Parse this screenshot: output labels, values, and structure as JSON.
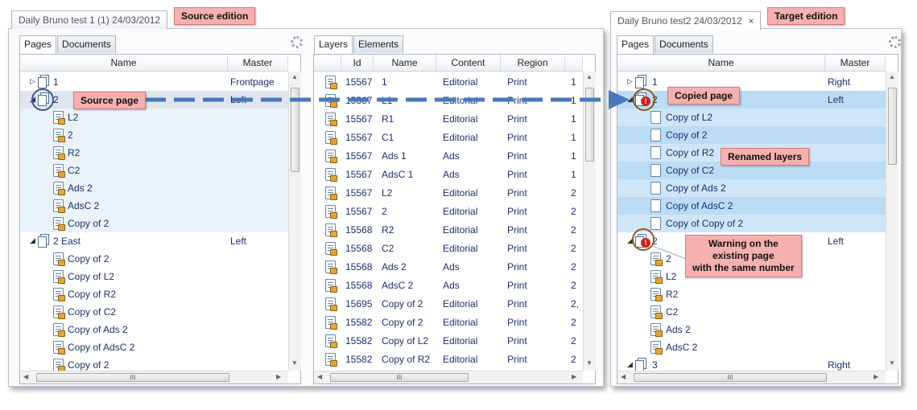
{
  "source": {
    "doc_tab": "Daily Bruno test 1 (1) 24/03/2012",
    "callout": "Source edition",
    "tabs": [
      "Pages",
      "Documents"
    ],
    "columns": [
      "Name",
      "Master"
    ],
    "rows": [
      {
        "name": "1",
        "master": "Frontpage"
      },
      {
        "name": "2",
        "master": "Left"
      },
      {
        "name": "L2",
        "master": ""
      },
      {
        "name": "2",
        "master": ""
      },
      {
        "name": "R2",
        "master": ""
      },
      {
        "name": "C2",
        "master": ""
      },
      {
        "name": "Ads 2",
        "master": ""
      },
      {
        "name": "AdsC 2",
        "master": ""
      },
      {
        "name": "Copy of 2",
        "master": ""
      },
      {
        "name": "2 East",
        "master": "Left"
      },
      {
        "name": "Copy of 2",
        "master": ""
      },
      {
        "name": "Copy of L2",
        "master": ""
      },
      {
        "name": "Copy of R2",
        "master": ""
      },
      {
        "name": "Copy of C2",
        "master": ""
      },
      {
        "name": "Copy of Ads 2",
        "master": ""
      },
      {
        "name": "Copy of AdsC 2",
        "master": ""
      },
      {
        "name": "Copy of 2",
        "master": ""
      }
    ],
    "source_page_callout": "Source page"
  },
  "middle": {
    "tabs": [
      "Layers",
      "Elements"
    ],
    "columns": [
      "Id",
      "Name",
      "Content",
      "Region"
    ],
    "rows": [
      [
        "15567",
        "1",
        "Editorial",
        "Print",
        "1"
      ],
      [
        "15567",
        "L1",
        "Editorial",
        "Print",
        "1"
      ],
      [
        "15567",
        "R1",
        "Editorial",
        "Print",
        "1"
      ],
      [
        "15567",
        "C1",
        "Editorial",
        "Print",
        "1"
      ],
      [
        "15567",
        "Ads 1",
        "Ads",
        "Print",
        "1"
      ],
      [
        "15567",
        "AdsC 1",
        "Ads",
        "Print",
        "1"
      ],
      [
        "15567",
        "L2",
        "Editorial",
        "Print",
        "2"
      ],
      [
        "15567",
        "2",
        "Editorial",
        "Print",
        "2"
      ],
      [
        "15568",
        "R2",
        "Editorial",
        "Print",
        "2"
      ],
      [
        "15568",
        "C2",
        "Editorial",
        "Print",
        "2"
      ],
      [
        "15568",
        "Ads 2",
        "Ads",
        "Print",
        "2"
      ],
      [
        "15568",
        "AdsC 2",
        "Ads",
        "Print",
        "2"
      ],
      [
        "15695",
        "Copy of 2",
        "Editorial",
        "Print",
        "2,"
      ],
      [
        "15582",
        "Copy of 2",
        "Editorial",
        "Print",
        "2"
      ],
      [
        "15582",
        "Copy of L2",
        "Editorial",
        "Print",
        "2"
      ],
      [
        "15582",
        "Copy of R2",
        "Editorial",
        "Print",
        "2"
      ]
    ]
  },
  "target": {
    "doc_tab": "Daily Bruno test2 24/03/2012",
    "close_glyph": "×",
    "callout": "Target edition",
    "tabs": [
      "Pages",
      "Documents"
    ],
    "columns": [
      "Name",
      "Master"
    ],
    "rows": [
      {
        "name": "1",
        "master": "Right"
      },
      {
        "name": "2",
        "master": "Left"
      },
      {
        "name": "Copy of L2",
        "master": ""
      },
      {
        "name": "Copy of 2",
        "master": ""
      },
      {
        "name": "Copy of R2",
        "master": ""
      },
      {
        "name": "Copy of C2",
        "master": ""
      },
      {
        "name": "Copy of Ads 2",
        "master": ""
      },
      {
        "name": "Copy of AdsC 2",
        "master": ""
      },
      {
        "name": "Copy of Copy of 2",
        "master": ""
      },
      {
        "name": "2",
        "master": "Left"
      },
      {
        "name": "2",
        "master": ""
      },
      {
        "name": "L2",
        "master": ""
      },
      {
        "name": "R2",
        "master": ""
      },
      {
        "name": "C2",
        "master": ""
      },
      {
        "name": "Ads 2",
        "master": ""
      },
      {
        "name": "AdsC 2",
        "master": ""
      },
      {
        "name": "3",
        "master": "Right"
      }
    ],
    "copied_callout": "Copied page",
    "renamed_callout": "Renamed layers",
    "warning_callout": [
      "Warning on the",
      "existing page",
      "with the same number"
    ]
  },
  "scroll_grip": "III",
  "icons": {
    "page": "page-icon",
    "layer": "locked-layer-icon",
    "blank_layer": "blank-layer-icon",
    "warning": "warning-icon",
    "settings": "gear-icon"
  },
  "colors": {
    "callout_bg": "#f7b0b0",
    "selection_blue": "#bcdcf4",
    "arrow_blue": "#4a78b8",
    "circle_brown": "#8b5a1e"
  }
}
